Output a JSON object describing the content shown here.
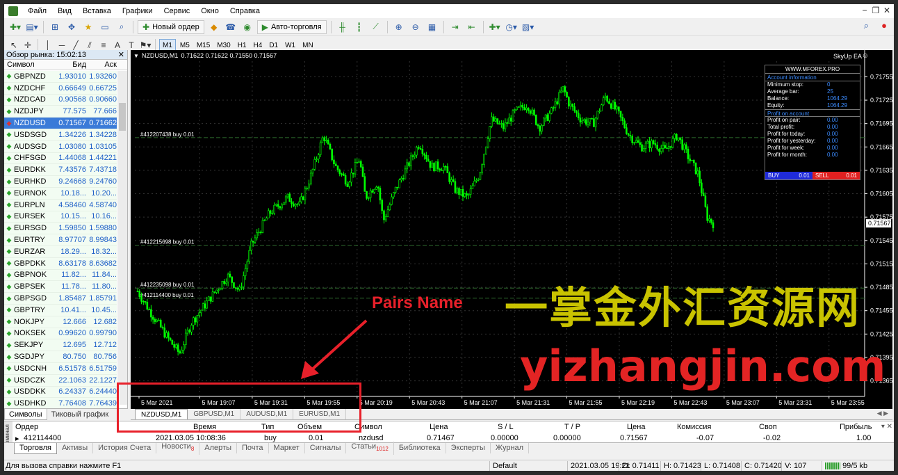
{
  "menu": [
    "Файл",
    "Вид",
    "Вставка",
    "Графики",
    "Сервис",
    "Окно",
    "Справка"
  ],
  "toolbar": {
    "new_order": "Новый ордер",
    "auto_trading": "Авто-торговля"
  },
  "timeframes": [
    "M1",
    "M5",
    "M15",
    "M30",
    "H1",
    "H4",
    "D1",
    "W1",
    "MN"
  ],
  "active_timeframe": "M1",
  "market_watch": {
    "title": "Обзор рынка: 15:02:13",
    "columns": [
      "Символ",
      "Бид",
      "Аск"
    ],
    "rows": [
      {
        "symbol": "GBPNZD",
        "bid": "1.93010",
        "ask": "1.93260"
      },
      {
        "symbol": "NZDCHF",
        "bid": "0.66649",
        "ask": "0.66725"
      },
      {
        "symbol": "NZDCAD",
        "bid": "0.90568",
        "ask": "0.90660"
      },
      {
        "symbol": "NZDJPY",
        "bid": "77.575",
        "ask": "77.666"
      },
      {
        "symbol": "NZDUSD",
        "bid": "0.71567",
        "ask": "0.71662"
      },
      {
        "symbol": "USDSGD",
        "bid": "1.34226",
        "ask": "1.34228"
      },
      {
        "symbol": "AUDSGD",
        "bid": "1.03080",
        "ask": "1.03105"
      },
      {
        "symbol": "CHFSGD",
        "bid": "1.44068",
        "ask": "1.44221"
      },
      {
        "symbol": "EURDKK",
        "bid": "7.43576",
        "ask": "7.43718"
      },
      {
        "symbol": "EURHKD",
        "bid": "9.24668",
        "ask": "9.24760"
      },
      {
        "symbol": "EURNOK",
        "bid": "10.18...",
        "ask": "10.20..."
      },
      {
        "symbol": "EURPLN",
        "bid": "4.58460",
        "ask": "4.58740"
      },
      {
        "symbol": "EURSEK",
        "bid": "10.15...",
        "ask": "10.16..."
      },
      {
        "symbol": "EURSGD",
        "bid": "1.59850",
        "ask": "1.59880"
      },
      {
        "symbol": "EURTRY",
        "bid": "8.97707",
        "ask": "8.99843"
      },
      {
        "symbol": "EURZAR",
        "bid": "18.29...",
        "ask": "18.32..."
      },
      {
        "symbol": "GBPDKK",
        "bid": "8.63178",
        "ask": "8.63682"
      },
      {
        "symbol": "GBPNOK",
        "bid": "11.82...",
        "ask": "11.84..."
      },
      {
        "symbol": "GBPSEK",
        "bid": "11.78...",
        "ask": "11.80..."
      },
      {
        "symbol": "GBPSGD",
        "bid": "1.85487",
        "ask": "1.85791"
      },
      {
        "symbol": "GBPTRY",
        "bid": "10.41...",
        "ask": "10.45..."
      },
      {
        "symbol": "NOKJPY",
        "bid": "12.666",
        "ask": "12.682"
      },
      {
        "symbol": "NOKSEK",
        "bid": "0.99620",
        "ask": "0.99790"
      },
      {
        "symbol": "SEKJPY",
        "bid": "12.695",
        "ask": "12.712"
      },
      {
        "symbol": "SGDJPY",
        "bid": "80.750",
        "ask": "80.756"
      },
      {
        "symbol": "USDCNH",
        "bid": "6.51578",
        "ask": "6.51759"
      },
      {
        "symbol": "USDCZK",
        "bid": "22.1063",
        "ask": "22.1227"
      },
      {
        "symbol": "USDDKK",
        "bid": "6.24337",
        "ask": "6.24440"
      },
      {
        "symbol": "USDHKD",
        "bid": "7.76408",
        "ask": "7.76439"
      }
    ],
    "selected_index": 4,
    "tabs": [
      "Символы",
      "Тиковый график"
    ]
  },
  "chart": {
    "title": "NZDUSD,M1",
    "ohlc": "0.71622 0.71622 0.71550 0.71567",
    "ea_name": "SkyUp EA",
    "ea_face": "☺",
    "current_price": "0.71567",
    "price_ticks": [
      "0.71755",
      "0.71725",
      "0.71695",
      "0.71665",
      "0.71635",
      "0.71605",
      "0.71575",
      "0.71545",
      "0.71515",
      "0.71485",
      "0.71455",
      "0.71425",
      "0.71395",
      "0.71365"
    ],
    "time_ticks": [
      "5 Mar 2021",
      "5 Mar 19:07",
      "5 Mar 19:31",
      "5 Mar 19:55",
      "5 Mar 20:19",
      "5 Mar 20:43",
      "5 Mar 21:07",
      "5 Mar 21:31",
      "5 Mar 21:55",
      "5 Mar 22:19",
      "5 Mar 22:43",
      "5 Mar 23:07",
      "5 Mar 23:31",
      "5 Mar 23:55"
    ],
    "order_lines": [
      {
        "label": "#412207438 buy 0.01",
        "price": 0.71677
      },
      {
        "label": "#412215698 buy 0.01",
        "price": 0.71539
      },
      {
        "label": "#412235098 buy 0.01",
        "price": 0.71484
      },
      {
        "label": "#412114400 buy 0.01",
        "price": 0.71471
      }
    ],
    "colors": {
      "candle": "#00ff00",
      "background": "#000000",
      "order_line": "#2e6b2e"
    }
  },
  "ea_panel": {
    "site": "WWW.MFOREX.PRO",
    "account_header": "Account information",
    "account_rows": [
      {
        "label": "Minimum stop:",
        "value": "0"
      },
      {
        "label": "Average bar:",
        "value": "25"
      },
      {
        "label": "Balance:",
        "value": "1064.29"
      },
      {
        "label": "Equity:",
        "value": "1064.29"
      }
    ],
    "profit_header": "Profit on account",
    "profit_rows": [
      {
        "label": "Profit on pair:",
        "value": "0.00"
      },
      {
        "label": "Total profit:",
        "value": "0.00"
      },
      {
        "label": "Profit for today:",
        "value": "0.00"
      },
      {
        "label": "Profit for yesterday:",
        "value": "0.00"
      },
      {
        "label": "Profit for week:",
        "value": "0.00"
      },
      {
        "label": "Profit for month:",
        "value": "0.00"
      }
    ],
    "buy_label": "BUY",
    "buy_value": "0.01",
    "sell_label": "SELL",
    "sell_value": "0.01"
  },
  "chart_tabs": [
    "NZDUSD,M1",
    "GBPUSD,M1",
    "AUDUSD,M1",
    "EURUSD,M1"
  ],
  "active_chart_tab": 0,
  "terminal": {
    "side_label": "Терминал",
    "columns": [
      "Ордер",
      "Время",
      "Тип",
      "Объем",
      "Символ",
      "Цена",
      "S / L",
      "T / P",
      "Цена",
      "Комиссия",
      "Своп",
      "Прибыль"
    ],
    "row": [
      "412114400",
      "2021.03.05 10:08:36",
      "buy",
      "0.01",
      "nzdusd",
      "0.71467",
      "0.00000",
      "0.00000",
      "0.71567",
      "-0.07",
      "-0.02",
      "1.00"
    ]
  },
  "terminal_tabs": [
    {
      "label": "Торговля",
      "badge": ""
    },
    {
      "label": "Активы",
      "badge": ""
    },
    {
      "label": "История Счета",
      "badge": ""
    },
    {
      "label": "Новости",
      "badge": "8"
    },
    {
      "label": "Алерты",
      "badge": ""
    },
    {
      "label": "Почта",
      "badge": ""
    },
    {
      "label": "Маркет",
      "badge": ""
    },
    {
      "label": "Сигналы",
      "badge": ""
    },
    {
      "label": "Статьи",
      "badge": "1012"
    },
    {
      "label": "Библиотека",
      "badge": ""
    },
    {
      "label": "Эксперты",
      "badge": ""
    },
    {
      "label": "Журнал",
      "badge": ""
    }
  ],
  "status": {
    "help": "Для вызова справки нажмите F1",
    "profile": "Default",
    "datetime": "2021.03.05 19:21",
    "open": "O: 0.71411",
    "high": "H: 0.71423",
    "low": "L: 0.71408",
    "close": "C: 0.71420",
    "volume": "V: 107",
    "traffic": "99/5 kb"
  },
  "annotation": {
    "label": "Pairs Name",
    "color": "#e8202a"
  },
  "watermark": {
    "cn": "一掌金外汇资源网",
    "en": "yizhangjin.com"
  }
}
